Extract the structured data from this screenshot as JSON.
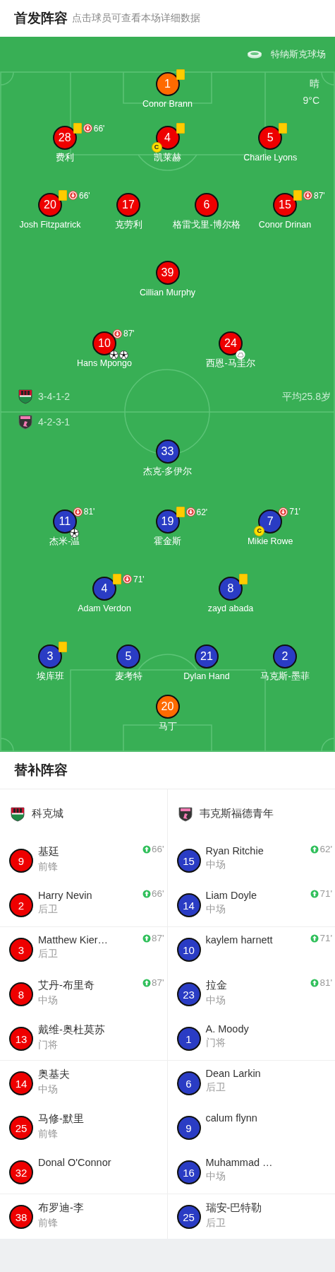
{
  "header": {
    "title": "首发阵容",
    "subtitle": "点击球员可查看本场详细数据"
  },
  "pitch": {
    "stadium": "特纳斯克球场",
    "weather": "晴",
    "temperature": "9°C",
    "average_age": "平均25.8岁",
    "home": {
      "formation": "3-4-1-2",
      "lines": [
        {
          "players": [
            {
              "number": "1",
              "name": "Conor Brann",
              "color": "#ff6a00",
              "yellow_card": true
            }
          ]
        },
        {
          "players": [
            {
              "number": "28",
              "name": "费利",
              "color": "#ee0000",
              "yellow_card": true,
              "sub_out": "66'"
            },
            {
              "number": "4",
              "name": "凯莱赫",
              "color": "#ee0000",
              "yellow_card": true,
              "captain_mark": "C"
            },
            {
              "number": "5",
              "name": "Charlie Lyons",
              "color": "#ee0000",
              "yellow_card": true
            }
          ]
        },
        {
          "players": [
            {
              "number": "20",
              "name": "Josh Fitzpatrick",
              "color": "#ee0000",
              "yellow_card": true,
              "sub_out": "66'"
            },
            {
              "number": "17",
              "name": "克劳利",
              "color": "#ee0000",
              "yellow_card": false
            },
            {
              "number": "6",
              "name": "格雷戈里-博尔格",
              "color": "#ee0000",
              "yellow_card": false
            },
            {
              "number": "15",
              "name": "Conor Drinan",
              "color": "#ee0000",
              "yellow_card": true,
              "sub_out": "87'"
            }
          ]
        },
        {
          "players": [
            {
              "number": "39",
              "name": "Cillian Murphy",
              "color": "#ee0000",
              "yellow_card": false
            }
          ]
        },
        {
          "players": [
            {
              "number": "10",
              "name": "Hans Mpongo",
              "color": "#ee0000",
              "yellow_card": false,
              "sub_out": "87'",
              "badges": [
                {
                  "kind": "goal"
                },
                {
                  "kind": "goal"
                }
              ]
            },
            {
              "number": "24",
              "name": "西恩-马圭尔",
              "color": "#ee0000",
              "yellow_card": false,
              "badges": [
                {
                  "kind": "assist"
                }
              ]
            }
          ]
        }
      ]
    },
    "away": {
      "formation": "4-2-3-1",
      "lines": [
        {
          "players": [
            {
              "number": "33",
              "name": "杰克-多伊尔",
              "color": "#2a3cc4",
              "yellow_card": false
            }
          ]
        },
        {
          "players": [
            {
              "number": "11",
              "name": "杰米-温",
              "color": "#2a3cc4",
              "yellow_card": false,
              "sub_out": "81'",
              "badges": [
                {
                  "kind": "goal"
                }
              ]
            },
            {
              "number": "19",
              "name": "霍金斯",
              "color": "#2a3cc4",
              "yellow_card": true,
              "sub_out": "62'"
            },
            {
              "number": "7",
              "name": "Mikie Rowe",
              "color": "#2a3cc4",
              "yellow_card": false,
              "sub_out": "71'",
              "captain_mark": "C"
            }
          ]
        },
        {
          "players": [
            {
              "number": "4",
              "name": "Adam Verdon",
              "color": "#2a3cc4",
              "yellow_card": true,
              "sub_out": "71'"
            },
            {
              "number": "8",
              "name": "zayd abada",
              "color": "#2a3cc4",
              "yellow_card": true
            }
          ]
        },
        {
          "players": [
            {
              "number": "3",
              "name": "埃库班",
              "color": "#2a3cc4",
              "yellow_card": true
            },
            {
              "number": "5",
              "name": "麦考特",
              "color": "#2a3cc4",
              "yellow_card": false
            },
            {
              "number": "21",
              "name": "Dylan Hand",
              "color": "#2a3cc4",
              "yellow_card": false
            },
            {
              "number": "2",
              "name": "马克斯-墨菲",
              "color": "#2a3cc4",
              "yellow_card": false
            }
          ]
        },
        {
          "players": [
            {
              "number": "20",
              "name": "马丁",
              "color": "#ff6a00",
              "yellow_card": false
            }
          ]
        }
      ]
    }
  },
  "substitutes": {
    "title": "替补阵容",
    "teams": [
      {
        "name": "科克城",
        "color": "#ee0000",
        "players": [
          {
            "number": "9",
            "name": "基廷",
            "position": "前锋",
            "sub_in": "66'"
          },
          {
            "number": "2",
            "name": "Harry Nevin",
            "position": "后卫",
            "sub_in": "66'"
          },
          {
            "number": "3",
            "name": "Matthew Kier…",
            "position": "后卫",
            "sub_in": "87'"
          },
          {
            "number": "8",
            "name": "艾丹-布里奇",
            "position": "中场",
            "sub_in": "87'"
          },
          {
            "number": "13",
            "name": "戴维-奥杜莫苏",
            "position": "门将"
          },
          {
            "number": "14",
            "name": "奥基夫",
            "position": "中场"
          },
          {
            "number": "25",
            "name": "马修-默里",
            "position": "前锋"
          },
          {
            "number": "32",
            "name": "Donal O'Connor"
          },
          {
            "number": "38",
            "name": "布罗迪-李",
            "position": "前锋"
          }
        ]
      },
      {
        "name": "韦克斯福德青年",
        "color": "#2a3cc4",
        "players": [
          {
            "number": "15",
            "name": "Ryan Ritchie",
            "position": "中场",
            "sub_in": "62'"
          },
          {
            "number": "14",
            "name": "Liam Doyle",
            "position": "中场",
            "sub_in": "71'"
          },
          {
            "number": "10",
            "name": "kaylem harnett",
            "sub_in": "71'"
          },
          {
            "number": "23",
            "name": "拉金",
            "position": "中场",
            "sub_in": "81'"
          },
          {
            "number": "1",
            "name": "A. Moody",
            "position": "门将"
          },
          {
            "number": "6",
            "name": "Dean Larkin",
            "position": "后卫"
          },
          {
            "number": "9",
            "name": "calum flynn"
          },
          {
            "number": "16",
            "name": "Muhammad …",
            "position": "中场"
          },
          {
            "number": "25",
            "name": "瑞安-巴特勒",
            "position": "后卫"
          }
        ]
      }
    ]
  }
}
